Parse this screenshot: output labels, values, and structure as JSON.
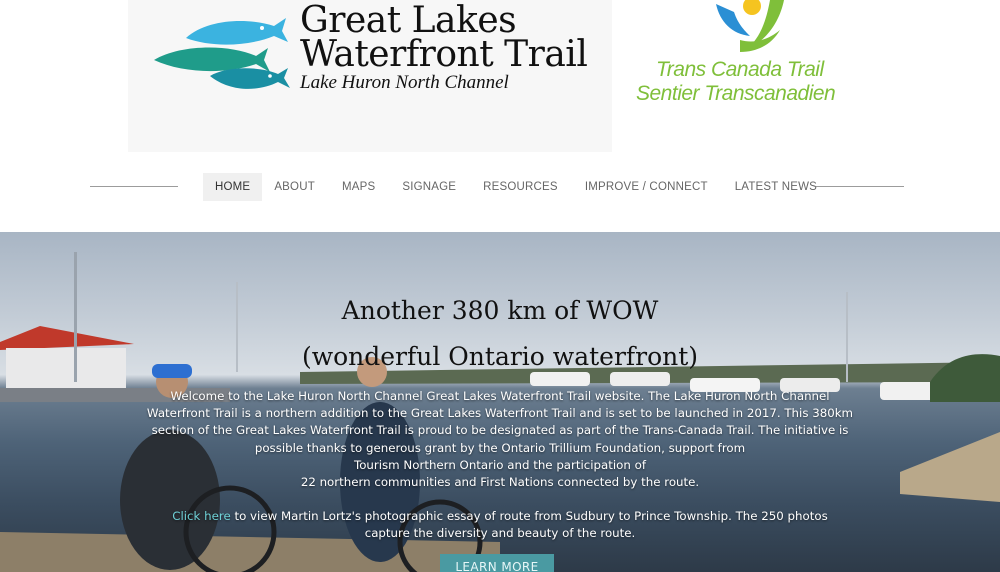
{
  "header": {
    "glwt_logo": {
      "line1": "Great Lakes",
      "line2": "Waterfront Trail",
      "subtitle": "Lake Huron North Channel",
      "fish_colors": [
        "#3bb3e0",
        "#1f9c8a",
        "#1a8fa3"
      ]
    },
    "tct_logo": {
      "line1": "Trans Canada Trail",
      "line2": "Sentier Transcanadien",
      "colors": {
        "text": "#7fbf3a",
        "blue": "#2b8fd4",
        "yellow": "#f5c420",
        "green": "#7fbf3a"
      }
    }
  },
  "nav": {
    "items": [
      {
        "label": "HOME",
        "active": true
      },
      {
        "label": "ABOUT",
        "active": false
      },
      {
        "label": "MAPS",
        "active": false
      },
      {
        "label": "SIGNAGE",
        "active": false
      },
      {
        "label": "RESOURCES",
        "active": false
      },
      {
        "label": "IMPROVE / CONNECT",
        "active": false
      },
      {
        "label": "LATEST NEWS",
        "active": false
      }
    ]
  },
  "hero": {
    "heading_line1": "Another 380 km of WOW",
    "heading_line2": "(wonderful Ontario waterfront)",
    "body_lines": [
      "Welcome to the Lake Huron North Channel Great Lakes Waterfront Trail website. The Lake Huron North Channel",
      "Waterfront Trail is a northern addition to the Great Lakes Waterfront Trail and is set to be launched in 2017. This 380km",
      "section of the Great Lakes Waterfront Trail is proud to be designated as part of the Trans-Canada Trail. The initiative is",
      "possible thanks to generous grant by the Ontario Trillium Foundation, support from",
      "Tourism Northern Ontario and the participation of",
      "22 northern communities and First Nations connected by the route."
    ],
    "link_text": "Click here",
    "link_rest": " to view Martin Lortz's photographic essay of route from Sudbury to Prince Township. The 250 photos",
    "link_line2": "capture the diversity and beauty of the route.",
    "button_label": "LEARN MORE"
  },
  "colors": {
    "accent": "#4a9aa2",
    "link": "#6fd0d6"
  }
}
